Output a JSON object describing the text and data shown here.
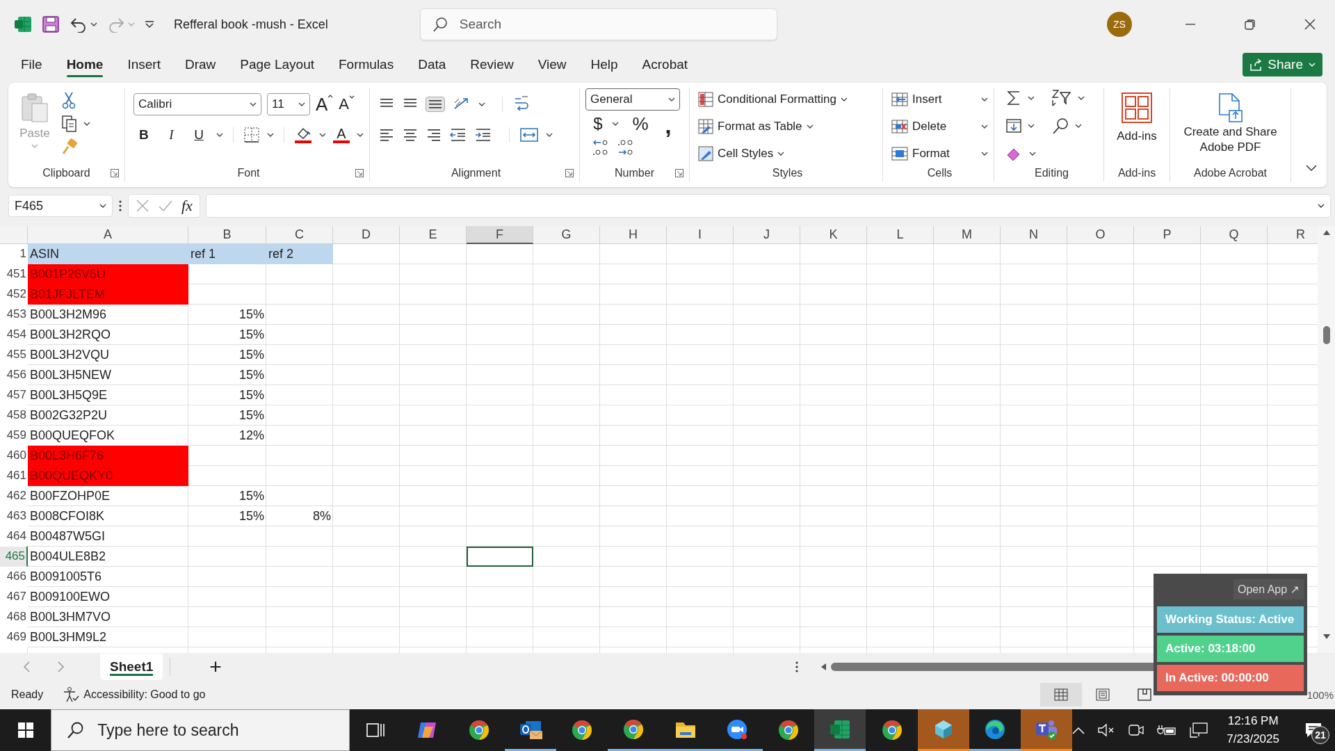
{
  "title_bar": {
    "title": "Refferal book -mush  -  Excel",
    "search_placeholder": "Search",
    "avatar": "ZS"
  },
  "ribbon_tabs": [
    {
      "label": "File",
      "selected": false
    },
    {
      "label": "Home",
      "selected": true
    },
    {
      "label": "Insert",
      "selected": false
    },
    {
      "label": "Draw",
      "selected": false
    },
    {
      "label": "Page Layout",
      "selected": false
    },
    {
      "label": "Formulas",
      "selected": false
    },
    {
      "label": "Data",
      "selected": false
    },
    {
      "label": "Review",
      "selected": false
    },
    {
      "label": "View",
      "selected": false
    },
    {
      "label": "Help",
      "selected": false
    },
    {
      "label": "Acrobat",
      "selected": false
    }
  ],
  "share_button": "Share",
  "ribbon": {
    "clipboard": {
      "label": "Clipboard",
      "paste": "Paste"
    },
    "font": {
      "label": "Font",
      "family": "Calibri",
      "size": "11",
      "grow": "A",
      "shrink": "A",
      "bold": "B",
      "italic": "I",
      "underline": "U",
      "color_letter": "A"
    },
    "alignment": {
      "label": "Alignment"
    },
    "number": {
      "label": "Number",
      "format": "General",
      "currency": "$",
      "percent": "%",
      "comma": ","
    },
    "styles": {
      "label": "Styles",
      "items": [
        {
          "label": "Conditional Formatting",
          "kind": "conditional"
        },
        {
          "label": "Format as Table",
          "kind": "table"
        },
        {
          "label": "Cell Styles",
          "kind": "cell_styles"
        }
      ]
    },
    "cells": {
      "label": "Cells",
      "items": [
        {
          "label": "Insert",
          "kind": "insert"
        },
        {
          "label": "Delete",
          "kind": "delete"
        },
        {
          "label": "Format",
          "kind": "format"
        }
      ]
    },
    "editing": {
      "label": "Editing"
    },
    "addins": {
      "label": "Add-ins",
      "button": "Add-ins"
    },
    "acrobat": {
      "label": "Adobe Acrobat",
      "button": "Create and Share Adobe PDF"
    }
  },
  "formula_bar": {
    "name_box": "F465",
    "fx": "fx"
  },
  "sheet": {
    "columns": [
      {
        "label": "A",
        "selected": false
      },
      {
        "label": "B",
        "selected": false
      },
      {
        "label": "C",
        "selected": false
      },
      {
        "label": "D",
        "selected": false
      },
      {
        "label": "E",
        "selected": false
      },
      {
        "label": "F",
        "selected": true
      },
      {
        "label": "G",
        "selected": false
      },
      {
        "label": "H",
        "selected": false
      },
      {
        "label": "I",
        "selected": false
      },
      {
        "label": "J",
        "selected": false
      },
      {
        "label": "K",
        "selected": false
      },
      {
        "label": "L",
        "selected": false
      },
      {
        "label": "M",
        "selected": false
      },
      {
        "label": "N",
        "selected": false
      },
      {
        "label": "O",
        "selected": false
      },
      {
        "label": "P",
        "selected": false
      },
      {
        "label": "Q",
        "selected": false
      },
      {
        "label": "R",
        "selected": false
      }
    ],
    "header_row": {
      "number": "1",
      "cells": [
        "ASIN",
        "ref 1",
        "ref 2"
      ]
    },
    "rows": [
      {
        "number": "451",
        "a": "B001P26V5U",
        "highlighted": true,
        "selected": false
      },
      {
        "number": "452",
        "a": "B01JFJLTEM",
        "highlighted": true,
        "selected": false
      },
      {
        "number": "453",
        "a": "B00L3H2M96",
        "b": "15%",
        "highlighted": false,
        "selected": false
      },
      {
        "number": "454",
        "a": "B00L3H2RQO",
        "b": "15%",
        "highlighted": false,
        "selected": false
      },
      {
        "number": "455",
        "a": "B00L3H2VQU",
        "b": "15%",
        "highlighted": false,
        "selected": false
      },
      {
        "number": "456",
        "a": "B00L3H5NEW",
        "b": "15%",
        "highlighted": false,
        "selected": false
      },
      {
        "number": "457",
        "a": "B00L3H5Q9E",
        "b": "15%",
        "highlighted": false,
        "selected": false
      },
      {
        "number": "458",
        "a": "B002G32P2U",
        "b": "15%",
        "highlighted": false,
        "selected": false
      },
      {
        "number": "459",
        "a": "B00QUEQFOK",
        "b": "12%",
        "highlighted": false,
        "selected": false
      },
      {
        "number": "460",
        "a": "B00L3H6F76",
        "highlighted": true,
        "selected": false
      },
      {
        "number": "461",
        "a": "B00QUEQKY0",
        "highlighted": true,
        "selected": false
      },
      {
        "number": "462",
        "a": "B00FZOHP0E",
        "b": "15%",
        "highlighted": false,
        "selected": false
      },
      {
        "number": "463",
        "a": "B008CFOI8K",
        "b": "15%",
        "c": "8%",
        "highlighted": false,
        "selected": false
      },
      {
        "number": "464",
        "a": "B00487W5GI",
        "highlighted": false,
        "selected": false
      },
      {
        "number": "465",
        "a": "B004ULE8B2",
        "highlighted": false,
        "selected": true
      },
      {
        "number": "466",
        "a": "B0091005T6",
        "highlighted": false,
        "selected": false
      },
      {
        "number": "467",
        "a": "B009100EWO",
        "highlighted": false,
        "selected": false
      },
      {
        "number": "468",
        "a": "B00L3HM7VO",
        "highlighted": false,
        "selected": false
      },
      {
        "number": "469",
        "a": "B00L3HM9L2",
        "highlighted": false,
        "selected": false
      }
    ]
  },
  "sheet_tabs": {
    "tabs": [
      {
        "label": "Sheet1",
        "selected": true
      }
    ],
    "add": "+"
  },
  "status_bar": {
    "status": "Ready",
    "accessibility": "Accessibility: Good to go",
    "views": [
      {
        "kind": "normal",
        "selected": true
      },
      {
        "kind": "page_layout",
        "selected": false
      },
      {
        "kind": "page_break",
        "selected": false
      }
    ],
    "zoom": "100%"
  },
  "tracker": {
    "open_app": "Open App ↗",
    "items": [
      {
        "text": "Working Status: Active",
        "color": "#6cbfcd"
      },
      {
        "text": "Active: 03:18:00",
        "color": "#50d28c"
      },
      {
        "text": "In Active: 00:00:00",
        "color": "#e8685c"
      }
    ]
  },
  "taskbar": {
    "search_placeholder": "Type here to search",
    "apps": [
      {
        "kind": "task_view",
        "open": false,
        "selected": false,
        "attention": false
      },
      {
        "kind": "copilot",
        "open": false,
        "selected": false,
        "attention": false
      },
      {
        "kind": "chrome",
        "open": false,
        "selected": false,
        "attention": false
      },
      {
        "kind": "outlook",
        "open": true,
        "selected": false,
        "attention": false
      },
      {
        "kind": "chrome",
        "open": false,
        "selected": false,
        "attention": false
      },
      {
        "kind": "chrome",
        "open": true,
        "selected": false,
        "attention": false
      },
      {
        "kind": "files",
        "open": true,
        "selected": false,
        "attention": false
      },
      {
        "kind": "zoom",
        "open": true,
        "selected": false,
        "attention": false
      },
      {
        "kind": "chrome",
        "open": false,
        "selected": false,
        "attention": false
      },
      {
        "kind": "excel",
        "open": true,
        "selected": true,
        "attention": false
      },
      {
        "kind": "chrome",
        "open": false,
        "selected": false,
        "attention": false
      },
      {
        "kind": "cube",
        "open": true,
        "selected": false,
        "attention": true
      },
      {
        "kind": "edge",
        "open": true,
        "selected": false,
        "attention": false
      },
      {
        "kind": "teams",
        "open": true,
        "selected": false,
        "attention": true
      }
    ],
    "time": "12:16 PM",
    "date": "7/23/2025",
    "notifications": "21"
  }
}
